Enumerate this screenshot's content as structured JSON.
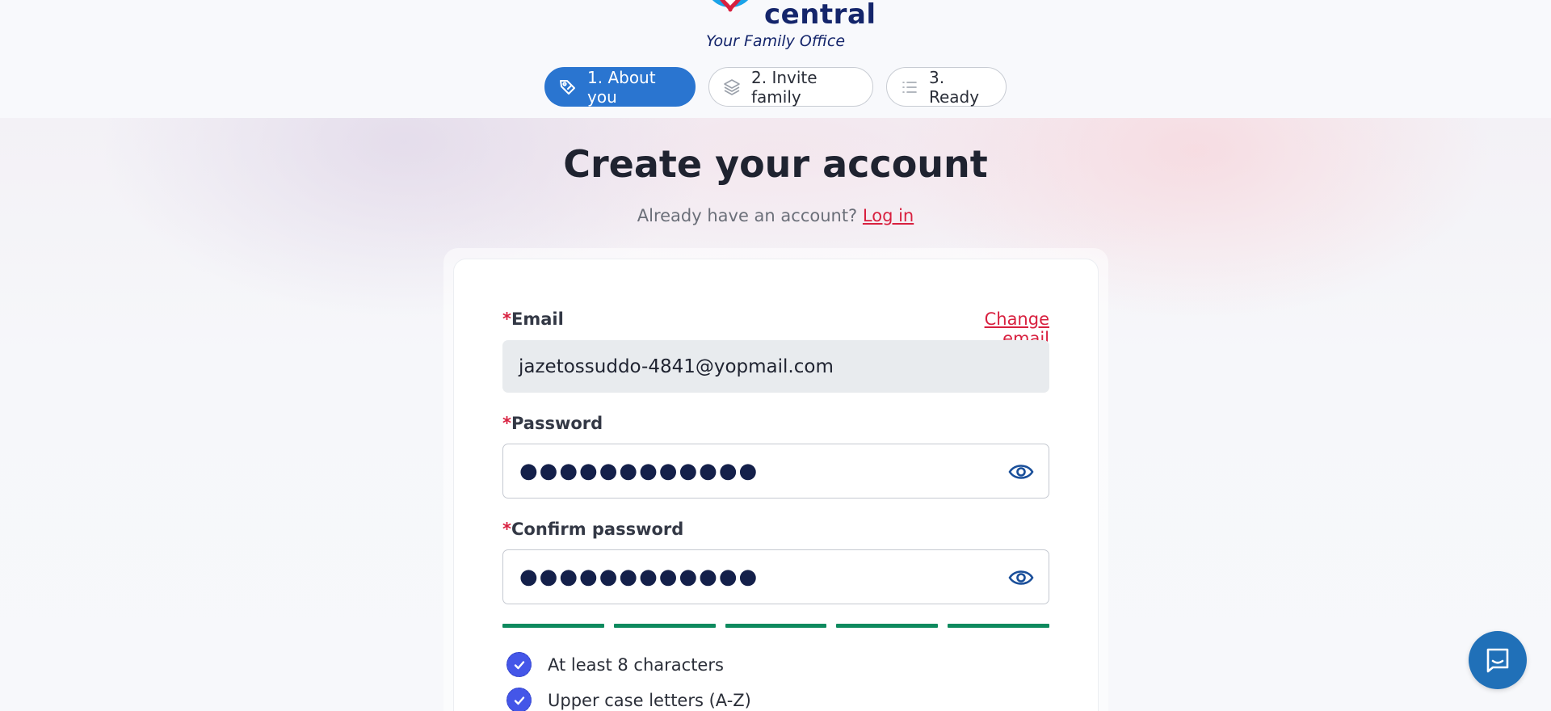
{
  "brand": {
    "name": "central",
    "tagline": "Your Family Office",
    "colors": {
      "navy": "#14256b",
      "heart_red": "#d8203f",
      "ring_blue": "#1aa3e8"
    }
  },
  "steps": [
    {
      "label": "1. About you",
      "icon": "tag-pen-icon",
      "active": true
    },
    {
      "label": "2. Invite family",
      "icon": "layers-icon",
      "active": false
    },
    {
      "label": "3. Ready",
      "icon": "list-icon",
      "active": false
    }
  ],
  "page": {
    "title": "Create your account",
    "login_prompt": "Already have an account?",
    "login_link": "Log in"
  },
  "form": {
    "email_label": "Email",
    "change_email": "Change email",
    "email_value": "jazetossuddo-4841@yopmail.com",
    "password_label": "Password",
    "password_value": "●●●●●●●●●●●●",
    "confirm_label": "Confirm password",
    "confirm_value": "●●●●●●●●●●●●",
    "required_mark": "*",
    "strength_segments_filled": 5,
    "strength_segments_total": 5,
    "strength_color": "#0d8a5e",
    "requirements": [
      {
        "text": "At least 8 characters",
        "met": true
      },
      {
        "text": "Upper case letters (A-Z)",
        "met": true
      }
    ]
  },
  "colors": {
    "accent": "#2a75d0",
    "link": "#d8203f",
    "check": "#4456e8",
    "chat": "#2070b8"
  },
  "chat": {
    "icon": "chat-icon"
  }
}
